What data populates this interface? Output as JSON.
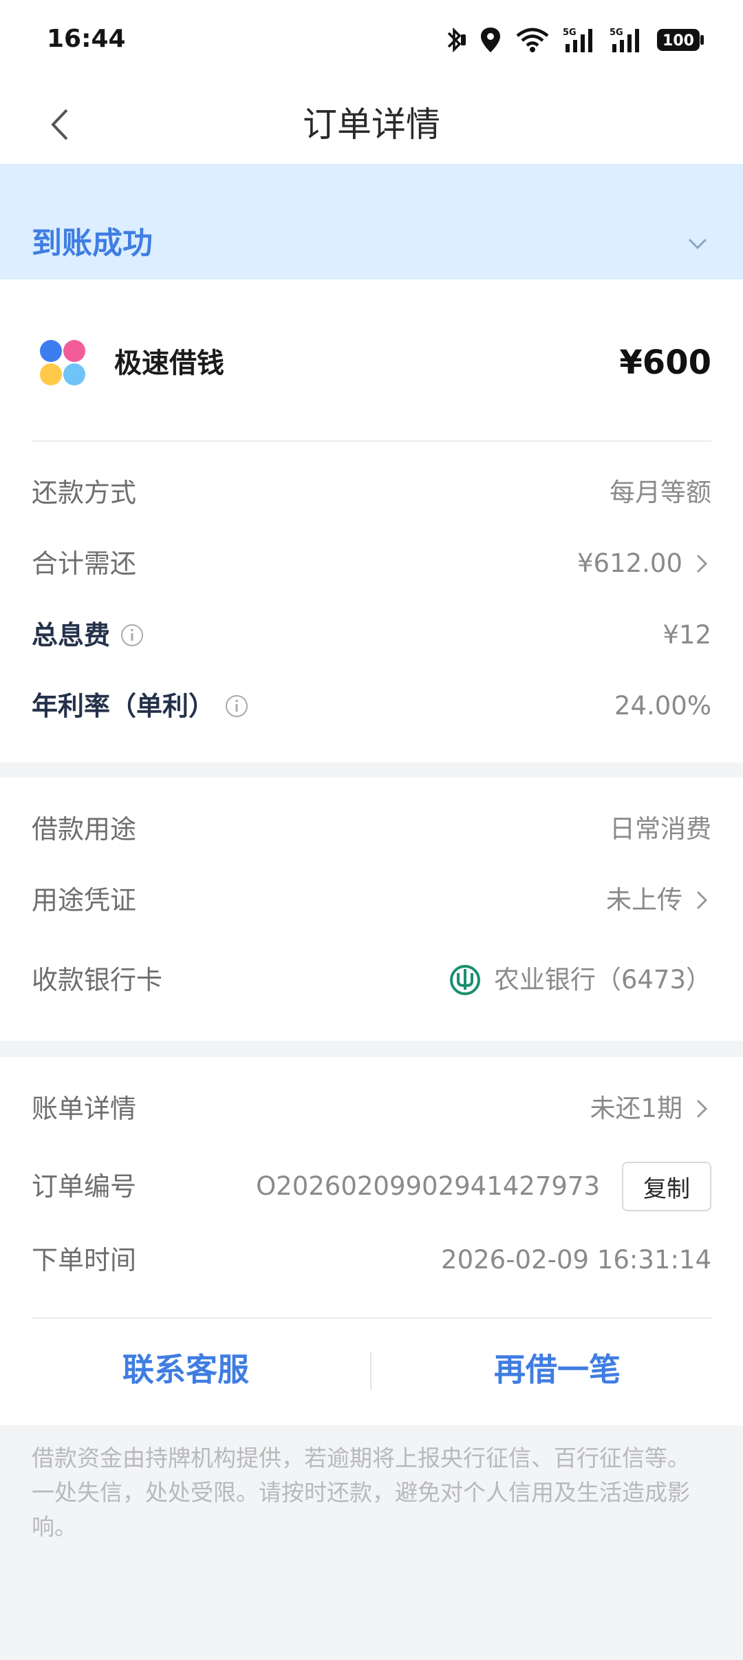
{
  "status_bar": {
    "time": "16:44",
    "battery": "100",
    "network_1": "5G",
    "network_2": "5G"
  },
  "nav": {
    "title": "订单详情"
  },
  "banner": {
    "status": "到账成功"
  },
  "product": {
    "name": "极速借钱",
    "amount": "¥600"
  },
  "loan_details": {
    "repayment_method_label": "还款方式",
    "repayment_method_value": "每月等额",
    "total_due_label": "合计需还",
    "total_due_value": "¥612.00",
    "total_interest_label": "总息费",
    "total_interest_value": "¥12",
    "annual_rate_label": "年利率（单利）",
    "annual_rate_value": "24.00%"
  },
  "purpose": {
    "purpose_label": "借款用途",
    "purpose_value": "日常消费",
    "voucher_label": "用途凭证",
    "voucher_value": "未上传",
    "bank_card_label": "收款银行卡",
    "bank_card_value": "农业银行（6473）"
  },
  "order": {
    "bill_label": "账单详情",
    "bill_value": "未还1期",
    "order_no_label": "订单编号",
    "order_no_value": "O20260209902941427973",
    "copy_label": "复制",
    "order_time_label": "下单时间",
    "order_time_value": "2026-02-09 16:31:14"
  },
  "actions": {
    "contact_label": "联系客服",
    "borrow_again_label": "再借一笔"
  },
  "disclaimer": "借款资金由持牌机构提供，若逾期将上报央行征信、百行征信等。一处失信，处处受限。请按时还款，避免对个人信用及生活造成影响。",
  "colors": {
    "accent": "#3f7de2",
    "banner_bg": "#dceeff",
    "bank_green": "#1a8f6e"
  }
}
